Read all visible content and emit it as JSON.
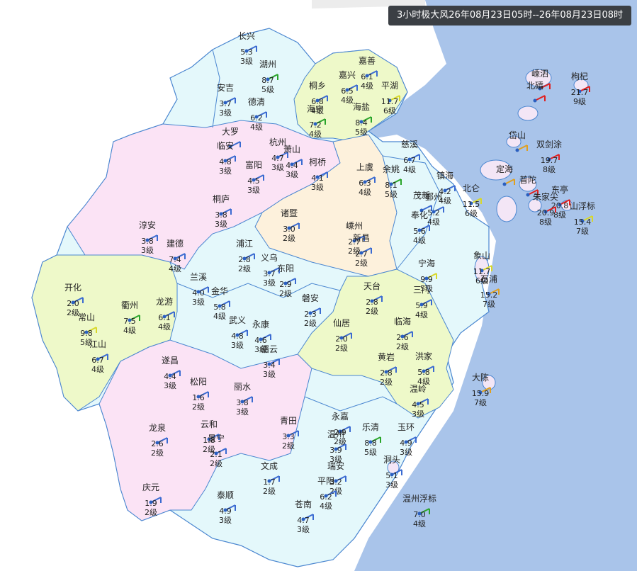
{
  "title": "3小时极大风26年08月23日05时--26年08月23日08时",
  "colors": {
    "sea": "#a9c4ea",
    "land_outside": "#ffffff",
    "border": "#3a78c9"
  },
  "stations": [
    {
      "name": "长兴",
      "speed": "5.3",
      "level": "3级",
      "color": "#3b6bd1"
    },
    {
      "name": "湖州",
      "speed": "8.7",
      "level": "5级",
      "color": "#2aa52a"
    },
    {
      "name": "安吉",
      "speed": "3.7",
      "level": "3级",
      "color": "#3b6bd1"
    },
    {
      "name": "德清",
      "speed": "6.2",
      "level": "4级",
      "color": "#3b6bd1"
    },
    {
      "name": "嘉善",
      "speed": "6.1",
      "level": "4级",
      "color": "#3b6bd1"
    },
    {
      "name": "嘉兴",
      "speed": "6.5",
      "level": "4级",
      "color": "#3b6bd1"
    },
    {
      "name": "平湖",
      "speed": "11.7",
      "level": "6级",
      "color": "#d8d82a"
    },
    {
      "name": "桐乡",
      "speed": "6.8",
      "level": "4级",
      "color": "#3b6bd1"
    },
    {
      "name": "海宁",
      "speed": "7.2",
      "level": "4级",
      "color": "#2aa52a"
    },
    {
      "name": "海盐",
      "speed": "8.4",
      "level": "5级",
      "color": "#2aa52a"
    },
    {
      "name": "大罗",
      "speed": "",
      "level": "",
      "color": "#3b6bd1"
    },
    {
      "name": "临安",
      "speed": "4.8",
      "level": "3级",
      "color": "#3b6bd1"
    },
    {
      "name": "杭州",
      "speed": "4.7",
      "level": "3级",
      "color": "#3b6bd1"
    },
    {
      "name": "萧山",
      "speed": "4.4",
      "level": "3级",
      "color": "#3b6bd1"
    },
    {
      "name": "富阳",
      "speed": "4.5",
      "level": "3级",
      "color": "#3b6bd1"
    },
    {
      "name": "柯桥",
      "speed": "4.1",
      "level": "3级",
      "color": "#3b6bd1"
    },
    {
      "name": "上虞",
      "speed": "6.3",
      "level": "4级",
      "color": "#3b6bd1"
    },
    {
      "name": "慈溪",
      "speed": "6.7",
      "level": "4级",
      "color": "#3b6bd1"
    },
    {
      "name": "余姚",
      "speed": "8.1",
      "level": "5级",
      "color": "#2aa52a"
    },
    {
      "name": "镇海",
      "speed": "4.2",
      "level": "4级",
      "color": "#3b6bd1"
    },
    {
      "name": "北仑",
      "speed": "11.5",
      "level": "6级",
      "color": "#d8d82a"
    },
    {
      "name": "嵊泗",
      "speed": "",
      "level": "",
      "color": "#e02020"
    },
    {
      "name": "北礵",
      "speed": "",
      "level": "",
      "color": "#e02020"
    },
    {
      "name": "枸杞",
      "speed": "21.7",
      "level": "9级",
      "color": "#e02020"
    },
    {
      "name": "岱山",
      "speed": "",
      "level": "",
      "color": "#e0a020"
    },
    {
      "name": "双剑涂",
      "speed": "19.7",
      "level": "8级",
      "color": "#e02020"
    },
    {
      "name": "定海",
      "speed": "",
      "level": "",
      "color": "#e0a020"
    },
    {
      "name": "普陀",
      "speed": "",
      "level": "",
      "color": "#e02020"
    },
    {
      "name": "东亭",
      "speed": "20.8",
      "level": "8级",
      "color": "#e02020"
    },
    {
      "name": "朱家尖",
      "speed": "20.9",
      "level": "8级",
      "color": "#e02020"
    },
    {
      "name": "山浮标",
      "speed": "15.4",
      "level": "7级",
      "color": "#d8d82a"
    },
    {
      "name": "桐庐",
      "speed": "3.8",
      "level": "3级",
      "color": "#3b6bd1"
    },
    {
      "name": "诸暨",
      "speed": "3.0",
      "level": "2级",
      "color": "#3b6bd1"
    },
    {
      "name": "嵊州",
      "speed": "2.7",
      "level": "2级",
      "color": "#3b6bd1"
    },
    {
      "name": "新昌",
      "speed": "2.7",
      "level": "2级",
      "color": "#3b6bd1"
    },
    {
      "name": "茂新",
      "speed": "",
      "level": "",
      "color": "#3b6bd1"
    },
    {
      "name": "鄞州",
      "speed": "5.2",
      "level": "4级",
      "color": "#3b6bd1"
    },
    {
      "name": "奉化",
      "speed": "5.6",
      "level": "4级",
      "color": "#3b6bd1"
    },
    {
      "name": "淳安",
      "speed": "3.8",
      "level": "3级",
      "color": "#3b6bd1"
    },
    {
      "name": "建德",
      "speed": "7.4",
      "level": "4级",
      "color": "#3b6bd1"
    },
    {
      "name": "浦江",
      "speed": "2.8",
      "level": "2级",
      "color": "#3b6bd1"
    },
    {
      "name": "义乌",
      "speed": "3.7",
      "level": "3级",
      "color": "#3b6bd1"
    },
    {
      "name": "东阳",
      "speed": "2.9",
      "level": "2级",
      "color": "#3b6bd1"
    },
    {
      "name": "象山",
      "speed": "11.7",
      "level": "6级",
      "color": "#d8d82a"
    },
    {
      "name": "石浦",
      "speed": "15.2",
      "level": "7级",
      "color": "#e0a020"
    },
    {
      "name": "宁海",
      "speed": "9.9",
      "level": "5级",
      "color": "#d8d82a"
    },
    {
      "name": "三门",
      "speed": "5.9",
      "level": "4级",
      "color": "#3b6bd1"
    },
    {
      "name": "兰溪",
      "speed": "4.0",
      "level": "3级",
      "color": "#3b6bd1"
    },
    {
      "name": "金华",
      "speed": "5.8",
      "level": "4级",
      "color": "#3b6bd1"
    },
    {
      "name": "磐安",
      "speed": "2.3",
      "level": "2级",
      "color": "#3b6bd1"
    },
    {
      "name": "天台",
      "speed": "2.8",
      "level": "2级",
      "color": "#3b6bd1"
    },
    {
      "name": "开化",
      "speed": "2.0",
      "level": "2级",
      "color": "#3b6bd1"
    },
    {
      "name": "衢州",
      "speed": "7.5",
      "level": "4级",
      "color": "#2aa52a"
    },
    {
      "name": "龙游",
      "speed": "6.1",
      "level": "4级",
      "color": "#3b6bd1"
    },
    {
      "name": "常山",
      "speed": "9.8",
      "level": "5级",
      "color": "#d8d82a"
    },
    {
      "name": "江山",
      "speed": "6.7",
      "level": "4级",
      "color": "#3b6bd1"
    },
    {
      "name": "武义",
      "speed": "4.8",
      "level": "3级",
      "color": "#3b6bd1"
    },
    {
      "name": "永康",
      "speed": "4.6",
      "level": "3级",
      "color": "#3b6bd1"
    },
    {
      "name": "缙云",
      "speed": "3.4",
      "level": "3级",
      "color": "#3b6bd1"
    },
    {
      "name": "仙居",
      "speed": "2.0",
      "level": "2级",
      "color": "#3b6bd1"
    },
    {
      "name": "临海",
      "speed": "2.6",
      "level": "2级",
      "color": "#3b6bd1"
    },
    {
      "name": "遂昌",
      "speed": "4.4",
      "level": "3级",
      "color": "#3b6bd1"
    },
    {
      "name": "松阳",
      "speed": "1.6",
      "level": "2级",
      "color": "#3b6bd1"
    },
    {
      "name": "丽水",
      "speed": "3.8",
      "level": "3级",
      "color": "#3b6bd1"
    },
    {
      "name": "黄岩",
      "speed": "2.8",
      "level": "2级",
      "color": "#3b6bd1"
    },
    {
      "name": "洪家",
      "speed": "5.8",
      "level": "4级",
      "color": "#3b6bd1"
    },
    {
      "name": "大陈",
      "speed": "15.9",
      "level": "7级",
      "color": "#e0a020"
    },
    {
      "name": "温岭",
      "speed": "4.5",
      "level": "3级",
      "color": "#3b6bd1"
    },
    {
      "name": "龙泉",
      "speed": "2.6",
      "level": "2级",
      "color": "#3b6bd1"
    },
    {
      "name": "云和",
      "speed": "1.8",
      "level": "2级",
      "color": "#3b6bd1"
    },
    {
      "name": "景宁",
      "speed": "2.1",
      "level": "2级",
      "color": "#3b6bd1"
    },
    {
      "name": "青田",
      "speed": "3.3",
      "level": "2级",
      "color": "#3b6bd1"
    },
    {
      "name": "永嘉",
      "speed": "2.9",
      "level": "2级",
      "color": "#3b6bd1"
    },
    {
      "name": "温州",
      "speed": "3.9",
      "level": "3级",
      "color": "#3b6bd1"
    },
    {
      "name": "乐清",
      "speed": "8.8",
      "level": "5级",
      "color": "#2aa52a"
    },
    {
      "name": "玉环",
      "speed": "4.9",
      "level": "3级",
      "color": "#3b6bd1"
    },
    {
      "name": "庆元",
      "speed": "1.9",
      "level": "2级",
      "color": "#3b6bd1"
    },
    {
      "name": "文成",
      "speed": "1.7",
      "level": "2级",
      "color": "#3b6bd1"
    },
    {
      "name": "瑞安",
      "speed": "3.2",
      "level": "2级",
      "color": "#3b6bd1"
    },
    {
      "name": "洞头",
      "speed": "5.1",
      "level": "3级",
      "color": "#3b6bd1"
    },
    {
      "name": "平阳",
      "speed": "6.2",
      "level": "4级",
      "color": "#3b6bd1"
    },
    {
      "name": "泰顺",
      "speed": "4.9",
      "level": "3级",
      "color": "#3b6bd1"
    },
    {
      "name": "苍南",
      "speed": "4.7",
      "level": "3级",
      "color": "#3b6bd1"
    },
    {
      "name": "温州浮标",
      "speed": "7.0",
      "level": "4级",
      "color": "#2aa52a"
    }
  ]
}
